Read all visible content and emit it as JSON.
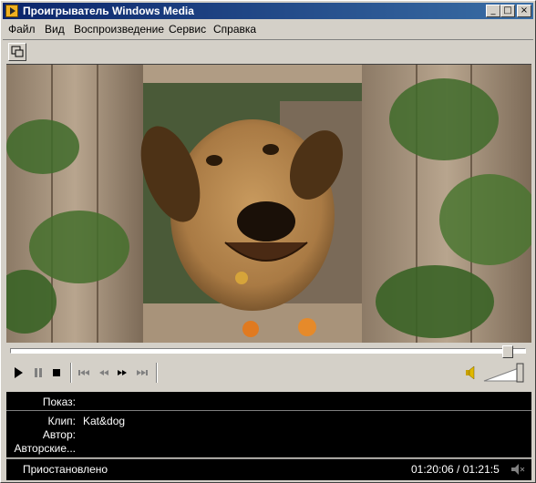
{
  "window": {
    "title": "Проигрыватель Windows Media",
    "buttons": {
      "minimize": "_",
      "maximize": "□",
      "close": "×"
    }
  },
  "menu": {
    "items": [
      {
        "label": "Файл"
      },
      {
        "label": "Вид"
      },
      {
        "label": "Воспроизведение"
      },
      {
        "label": "Сервис"
      },
      {
        "label": "Справка"
      }
    ]
  },
  "info": {
    "show_label": "Показ:",
    "show_value": "",
    "clip_label": "Клип:",
    "clip_value": "Kat&dog",
    "author_label": "Автор:",
    "author_value": "",
    "copyright_label": "Авторские...",
    "copyright_value": ""
  },
  "status": {
    "state": "Приостановлено",
    "time": "01:20:06 / 01:21:5"
  },
  "playback": {
    "seek_position_fraction": 0.976,
    "volume_fraction": 0.95
  },
  "colors": {
    "title_gradient_start": "#0a246a",
    "title_gradient_end": "#3a6ea5",
    "panel_bg": "#d4d0c8",
    "info_bg": "#000000",
    "info_text": "#ffffff"
  },
  "icons": {
    "app": "windows-media-icon",
    "compact_mode": "compact-mode-icon",
    "play": "play-icon",
    "pause": "pause-icon",
    "stop": "stop-icon",
    "skip_back": "skip-back-icon",
    "rewind": "rewind-icon",
    "fast_forward": "fast-forward-icon",
    "skip_forward": "skip-forward-icon",
    "volume": "speaker-icon"
  }
}
